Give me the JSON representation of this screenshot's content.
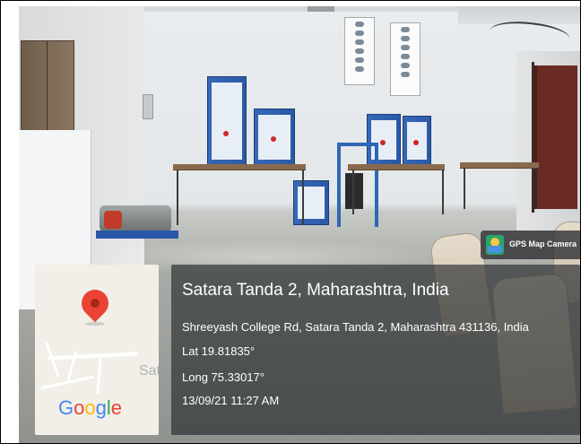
{
  "badge": {
    "label": "GPS Map Camera",
    "icon": "gps-map-camera-icon"
  },
  "map": {
    "town_label": "Sat",
    "brand_letters": [
      "G",
      "o",
      "o",
      "g",
      "l",
      "e"
    ],
    "pin_color": "#ea4335"
  },
  "location": {
    "title": "Satara Tanda 2, Maharashtra, India",
    "address": "Shreeyash College Rd, Satara Tanda 2, Maharashtra 431136, India",
    "latitude": "Lat 19.81835°",
    "longitude": "Long 75.33017°",
    "datetime": "13/09/21 11:27 AM"
  },
  "colors": {
    "overlay": "#282a2e",
    "equipment_blue": "#2f66b8",
    "table_wood": "#8a6a4d",
    "door": "#6c2a24"
  }
}
